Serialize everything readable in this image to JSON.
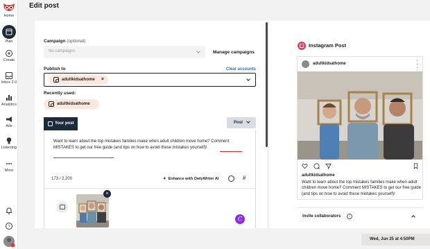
{
  "nav": {
    "items": [
      {
        "label": "Home",
        "icon": "owl-logo-icon"
      },
      {
        "label": "Plan",
        "icon": "calendar-icon"
      },
      {
        "label": "Create",
        "icon": "plus-circle-icon"
      },
      {
        "label": "Inbox 2.0",
        "icon": "inbox-icon"
      },
      {
        "label": "Analytics",
        "icon": "bar-chart-icon"
      },
      {
        "label": "Ads",
        "icon": "megaphone-icon"
      },
      {
        "label": "Listening",
        "icon": "lightbulb-icon"
      },
      {
        "label": "More",
        "icon": "ellipsis-icon"
      }
    ]
  },
  "header": {
    "title": "Edit post"
  },
  "editor": {
    "campaign_label": "Campaign",
    "campaign_optional": "(optional)",
    "campaign_placeholder": "No campaigns",
    "manage_campaigns": "Manage campaigns",
    "publish_to_label": "Publish to",
    "clear_accounts": "Clear accounts",
    "selected_profile": "adultkidsathome",
    "recently_used_label": "Recently used:",
    "recent_profile": "adultkidsathome",
    "tab_label": "Your post",
    "post_button": "Post",
    "caption_part1": "Want to learn about the top mistakes  families make when adult children move home? ",
    "caption_part2": "Comment MISTAKES to get our free guide",
    "caption_part3": " (and tips on how to avoid these mistakes yourself)!",
    "char_count": "173 / 2,200",
    "owly_button": "Enhance with OwlyWriter AI",
    "hashtag": "#",
    "canva_letter": "C"
  },
  "preview": {
    "title": "Instagram Post",
    "username": "adultkidsathome",
    "caption_user": "adultkidsathome",
    "caption": "Want to learn about the top mistakes  families make when adult children move home? Comment MISTAKES to get our free guide (and tips on how to avoid these mistakes yourself)!",
    "invite_collaborators": "Invite collaborators"
  },
  "footer": {
    "schedule_label": "Wed, Jun 25 at 4:50PM"
  },
  "colors": {
    "accent_red": "#d0312d",
    "navy": "#1c2b3a",
    "chip_bg": "#fde8dd",
    "instagram": "#e4405f",
    "canva": "#8d2de2"
  }
}
